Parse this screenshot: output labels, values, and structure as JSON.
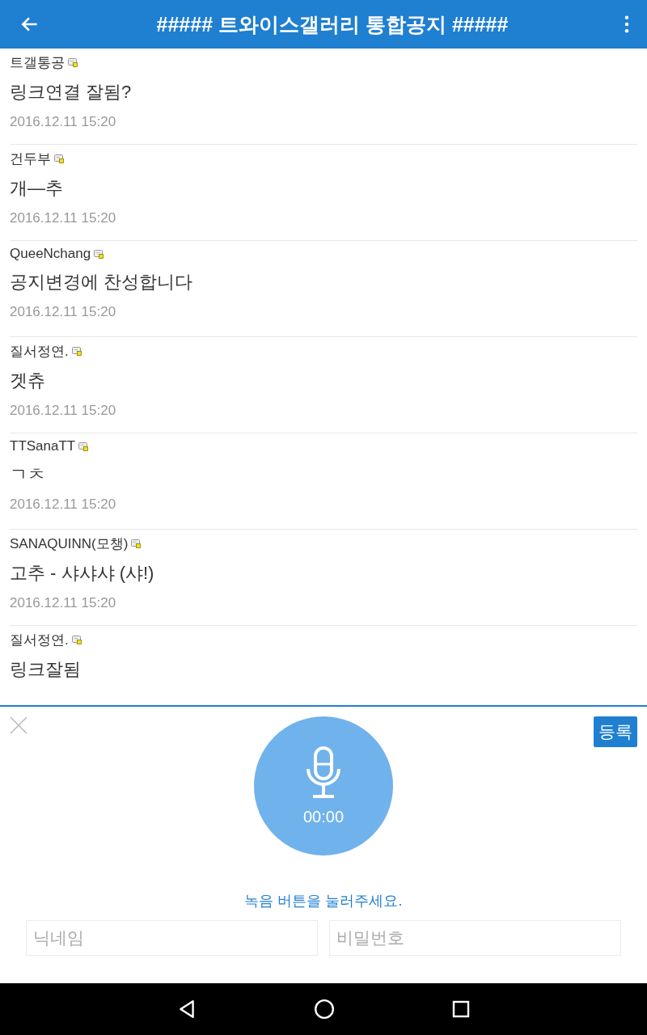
{
  "app_bar": {
    "title": "##### 트와이스갤러리 통합공지 #####"
  },
  "comments": [
    {
      "author": "트갤통공",
      "text": "링크연결 잘됨?",
      "time": "2016.12.11 15:20"
    },
    {
      "author": "건두부",
      "text": "개—추",
      "time": "2016.12.11 15:20"
    },
    {
      "author": "QueeNchang",
      "text": "공지변경에 찬성합니다",
      "time": "2016.12.11 15:20"
    },
    {
      "author": "질서정연.",
      "text": "겟츄",
      "time": "2016.12.11 15:20"
    },
    {
      "author": "TTSanaTT",
      "text": "ㄱㅊ",
      "time": "2016.12.11 15:20"
    },
    {
      "author": "SANAQUINN(모챙)",
      "text": "고추 - 샤샤샤 (샤!)",
      "time": "2016.12.11 15:20"
    },
    {
      "author": "질서정연.",
      "text": "링크잘됨"
    }
  ],
  "recorder": {
    "submit": "등록",
    "timer": "00:00",
    "prompt": "녹음 버튼을 눌러주세요.",
    "nickname": {
      "placeholder": "닉네임"
    },
    "password": {
      "placeholder": "비밀번호"
    }
  }
}
